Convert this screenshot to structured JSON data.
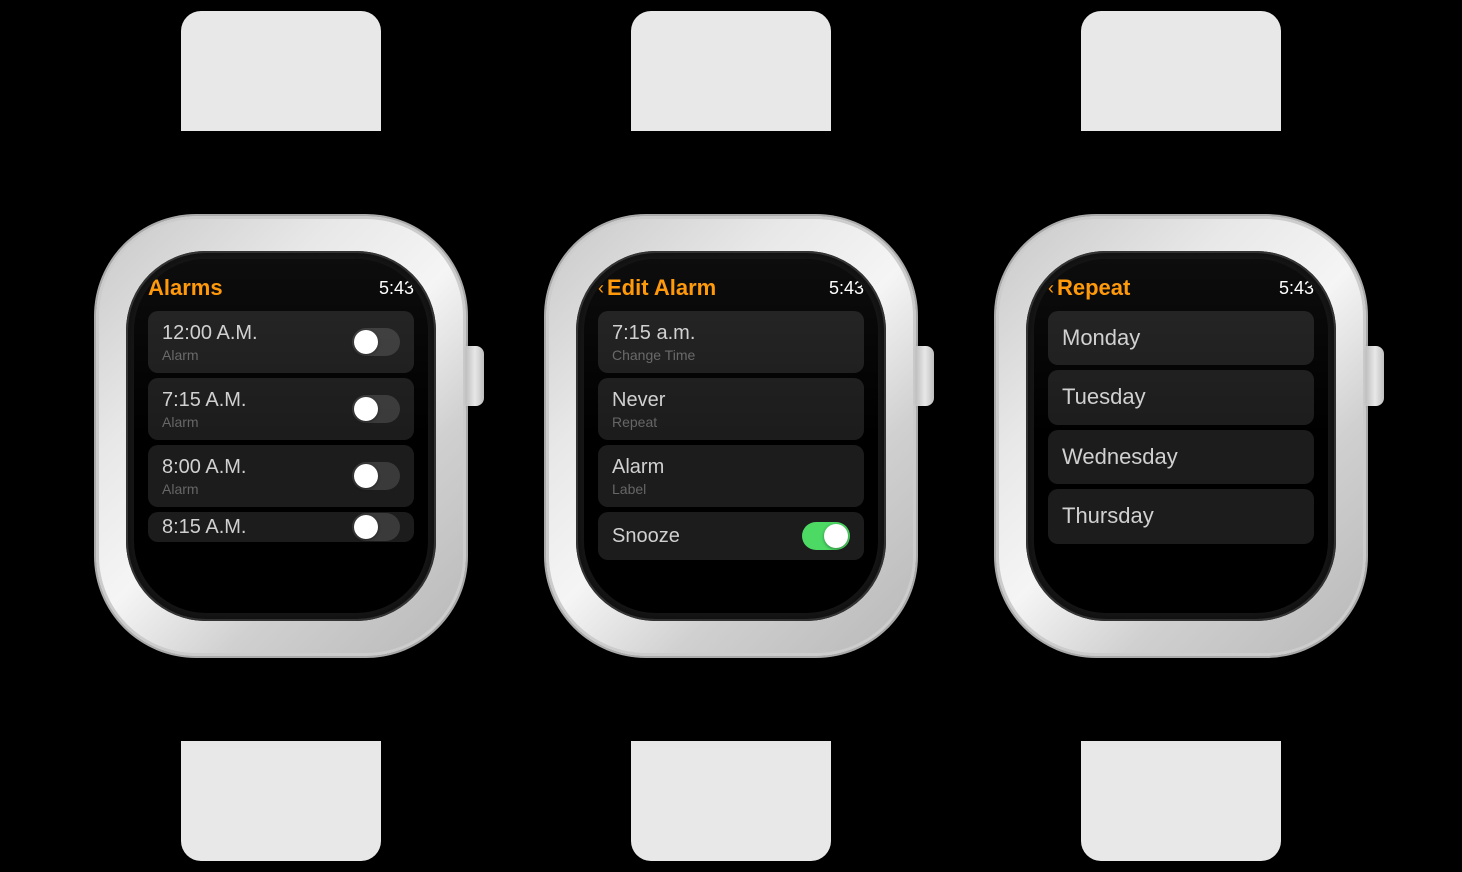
{
  "watches": [
    {
      "id": "alarms",
      "screen": {
        "title": "Alarms",
        "time": "5:43",
        "type": "alarms"
      },
      "alarms": [
        {
          "time": "12:00 A.M.",
          "label": "Alarm",
          "enabled": false
        },
        {
          "time": "7:15 A.M.",
          "label": "Alarm",
          "enabled": false
        },
        {
          "time": "8:00 A.M.",
          "label": "Alarm",
          "enabled": false
        },
        {
          "time": "8:15 A.M.",
          "label": "",
          "enabled": false,
          "partial": true
        }
      ]
    },
    {
      "id": "edit-alarm",
      "screen": {
        "title": "Edit Alarm",
        "time": "5:43",
        "type": "edit"
      },
      "items": [
        {
          "main": "7:15 a.m.",
          "sub": "Change Time"
        },
        {
          "main": "Never",
          "sub": "Repeat"
        },
        {
          "main": "Alarm",
          "sub": "Label"
        },
        {
          "main": "Snooze",
          "sub": null,
          "toggle": true,
          "toggleOn": true
        }
      ]
    },
    {
      "id": "repeat",
      "screen": {
        "title": "Repeat",
        "time": "5:43",
        "type": "repeat"
      },
      "days": [
        "Monday",
        "Tuesday",
        "Wednesday",
        "Thursday"
      ]
    }
  ],
  "colors": {
    "accent": "#FF9500",
    "toggle_on": "#4CD964",
    "list_bg": "#1c1c1c",
    "screen_bg": "#000000"
  }
}
